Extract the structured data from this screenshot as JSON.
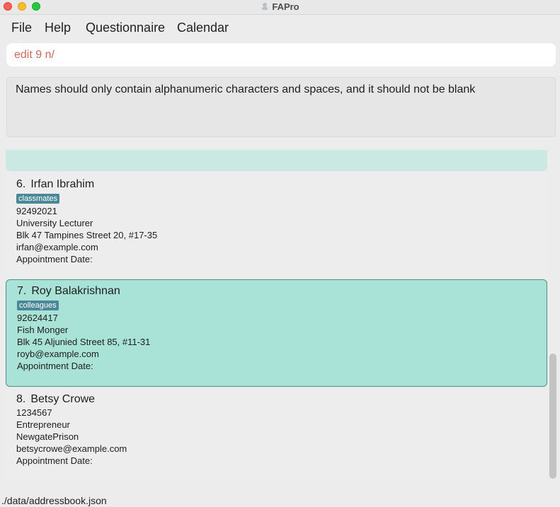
{
  "window": {
    "title": "FAPro"
  },
  "menu": [
    "File",
    "Help",
    "Questionnaire",
    "Calendar"
  ],
  "command": {
    "value": "edit 9 n/"
  },
  "result": {
    "message": "Names should only contain alphanumeric characters and spaces, and it should not be blank"
  },
  "persons": [
    {
      "index": "6.",
      "name": "Irfan Ibrahim",
      "tag": "classmates",
      "phone": "92492021",
      "occupation": "University Lecturer",
      "address": "Blk 47 Tampines Street 20, #17-35",
      "email": "irfan@example.com",
      "appointment": "Appointment Date:"
    },
    {
      "index": "7.",
      "name": "Roy Balakrishnan",
      "tag": "colleagues",
      "phone": "92624417",
      "occupation": "Fish Monger",
      "address": "Blk 45 Aljunied Street 85, #11-31",
      "email": "royb@example.com",
      "appointment": "Appointment Date:"
    },
    {
      "index": "8.",
      "name": "Betsy Crowe",
      "phone": "1234567",
      "occupation": "Entrepreneur",
      "address": "NewgatePrison",
      "email": "betsycrowe@example.com",
      "appointment": "Appointment Date:"
    }
  ],
  "status": {
    "file_path": "./data/addressbook.json"
  },
  "colors": {
    "selected_card": "#a9e2d6",
    "tag_background": "#4b8897",
    "command_text": "#d06a58"
  }
}
